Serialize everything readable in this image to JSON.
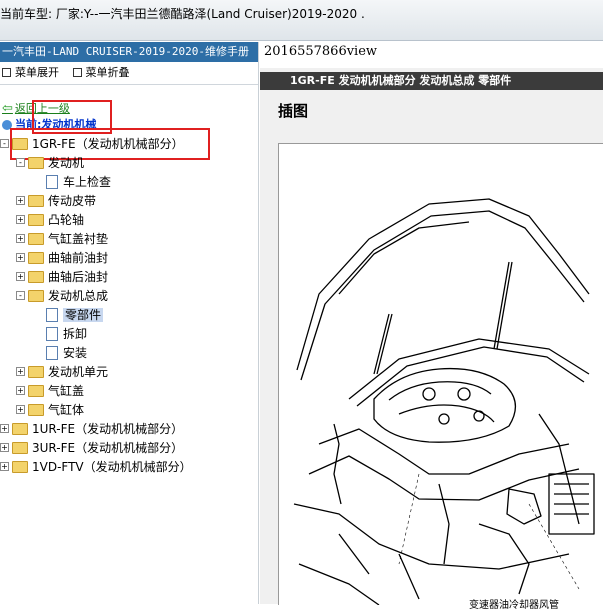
{
  "window": {
    "title": "当前车型:  厂家:Y--一汽丰田兰德酷路泽(Land Cruiser)2019-2020  ."
  },
  "sidebar": {
    "header": "一汽丰田-LAND CRUISER-2019-2020-维修手册",
    "expand_all": "菜单展开",
    "collapse_all": "菜单折叠",
    "back": "返回上一级",
    "current_prefix": "当前:",
    "current_value": "发动机机械",
    "tree": [
      {
        "label": "1GR-FE（发动机机械部分）",
        "level": 0,
        "kind": "folder",
        "exp": "-"
      },
      {
        "label": "发动机",
        "level": 1,
        "kind": "folder",
        "exp": "-"
      },
      {
        "label": "车上检查",
        "level": 2,
        "kind": "doc"
      },
      {
        "label": "传动皮带",
        "level": 1,
        "kind": "folder",
        "exp": "+"
      },
      {
        "label": "凸轮轴",
        "level": 1,
        "kind": "folder",
        "exp": "+"
      },
      {
        "label": "气缸盖衬垫",
        "level": 1,
        "kind": "folder",
        "exp": "+"
      },
      {
        "label": "曲轴前油封",
        "level": 1,
        "kind": "folder",
        "exp": "+"
      },
      {
        "label": "曲轴后油封",
        "level": 1,
        "kind": "folder",
        "exp": "+"
      },
      {
        "label": "发动机总成",
        "level": 1,
        "kind": "folder",
        "exp": "-"
      },
      {
        "label": "零部件",
        "level": 2,
        "kind": "doc",
        "selected": true
      },
      {
        "label": "拆卸",
        "level": 2,
        "kind": "doc"
      },
      {
        "label": "安装",
        "level": 2,
        "kind": "doc"
      },
      {
        "label": "发动机单元",
        "level": 1,
        "kind": "folder",
        "exp": "+"
      },
      {
        "label": "气缸盖",
        "level": 1,
        "kind": "folder",
        "exp": "+"
      },
      {
        "label": "气缸体",
        "level": 1,
        "kind": "folder",
        "exp": "+"
      },
      {
        "label": "1UR-FE（发动机机械部分）",
        "level": 0,
        "kind": "folder",
        "exp": "+"
      },
      {
        "label": "3UR-FE（发动机机械部分）",
        "level": 0,
        "kind": "folder",
        "exp": "+"
      },
      {
        "label": "1VD-FTV（发动机机械部分）",
        "level": 0,
        "kind": "folder",
        "exp": "+"
      }
    ]
  },
  "viewer": {
    "view_id": "2016557866view",
    "banner": "1GR-FE 发动机机械部分  发动机总成  零部件",
    "heading": "插图",
    "caption": "变速器油冷却器风管"
  }
}
